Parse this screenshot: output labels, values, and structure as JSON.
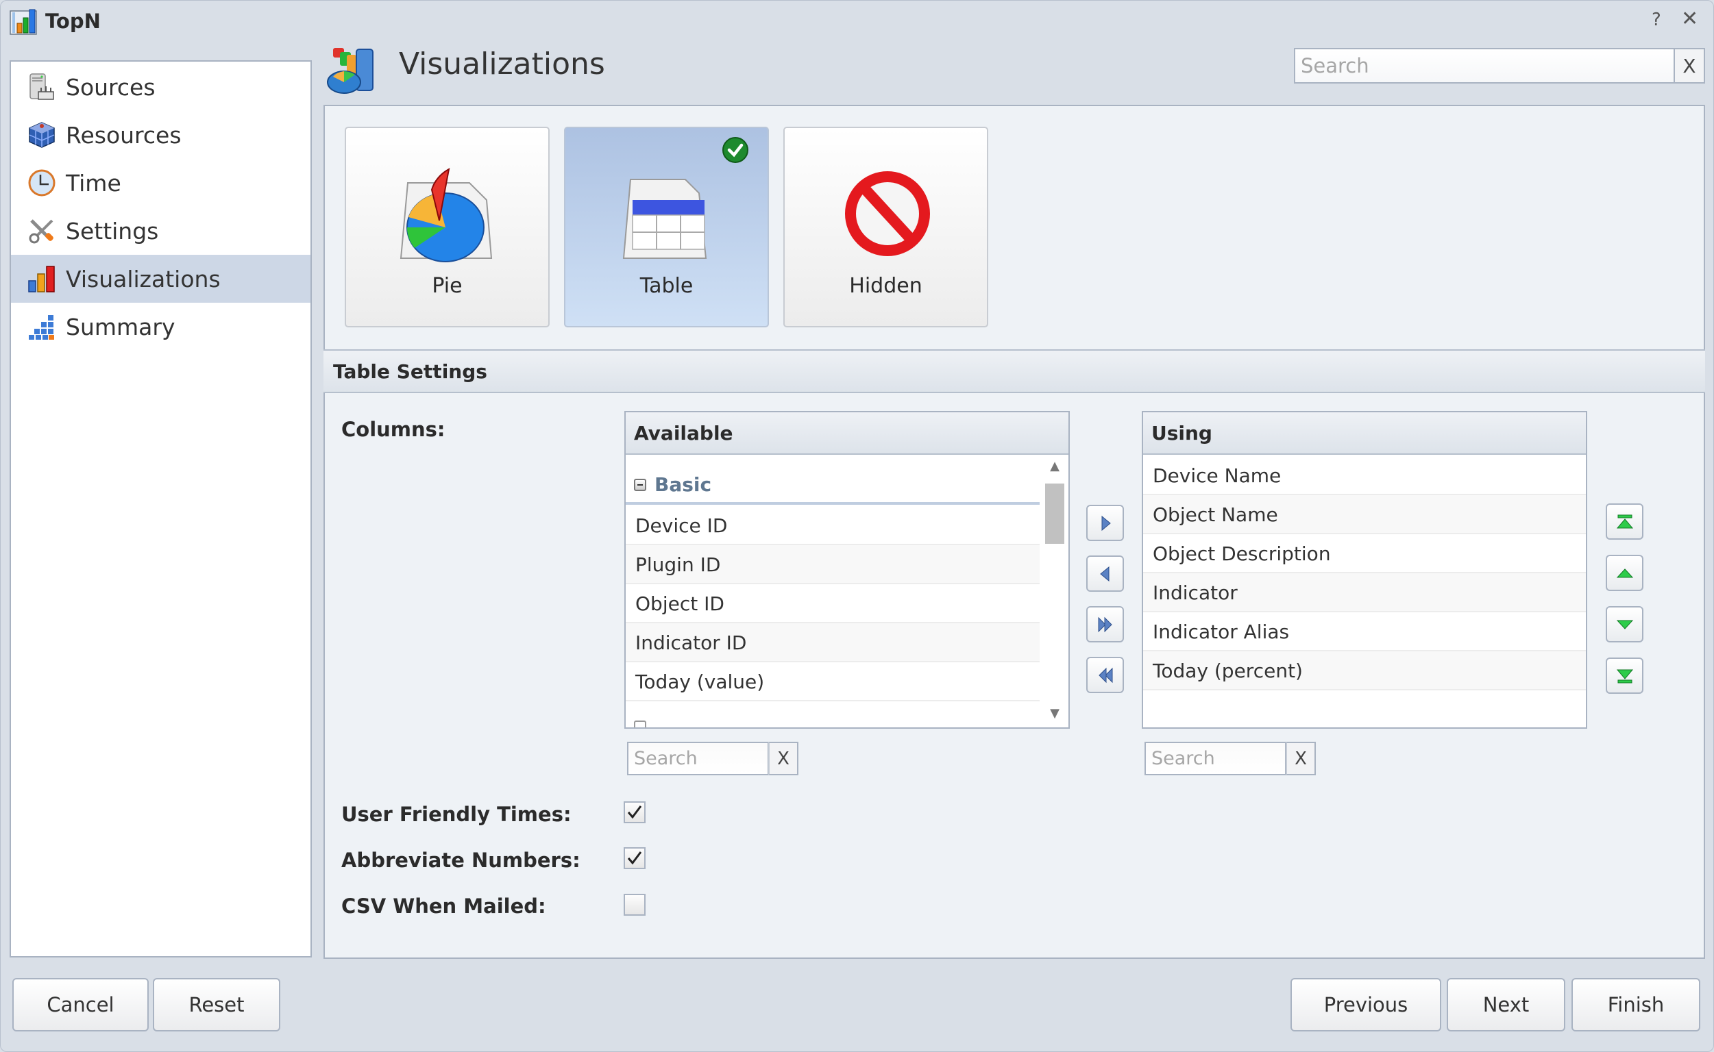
{
  "window": {
    "title": "TopN",
    "help_label": "?",
    "close_label": "✕"
  },
  "sidebar": {
    "items": [
      {
        "label": "Sources",
        "icon": "server-icon",
        "selected": false
      },
      {
        "label": "Resources",
        "icon": "cube-icon",
        "selected": false
      },
      {
        "label": "Time",
        "icon": "clock-icon",
        "selected": false
      },
      {
        "label": "Settings",
        "icon": "tools-icon",
        "selected": false
      },
      {
        "label": "Visualizations",
        "icon": "bar-chart-icon",
        "selected": true
      },
      {
        "label": "Summary",
        "icon": "summary-blocks-icon",
        "selected": false
      }
    ]
  },
  "header": {
    "title": "Visualizations",
    "search_placeholder": "Search",
    "search_value": "",
    "search_clear": "X"
  },
  "visualizations": {
    "tiles": [
      {
        "label": "Pie",
        "icon": "pie-chart-icon",
        "selected": false
      },
      {
        "label": "Table",
        "icon": "table-icon",
        "selected": true
      },
      {
        "label": "Hidden",
        "icon": "no-entry-icon",
        "selected": false
      }
    ]
  },
  "table_settings": {
    "title": "Table Settings",
    "columns_label": "Columns:",
    "available": {
      "header": "Available",
      "group": "Basic",
      "rows": [
        "Device ID",
        "Plugin ID",
        "Object ID",
        "Indicator ID",
        "Today (value)"
      ],
      "search_placeholder": "Search",
      "search_clear": "X"
    },
    "using": {
      "header": "Using",
      "rows": [
        "Device Name",
        "Object Name",
        "Object Description",
        "Indicator",
        "Indicator Alias",
        "Today (percent)"
      ],
      "search_placeholder": "Search",
      "search_clear": "X"
    },
    "options": [
      {
        "label": "User Friendly Times:",
        "checked": true
      },
      {
        "label": "Abbreviate Numbers:",
        "checked": true
      },
      {
        "label": "CSV When Mailed:",
        "checked": false
      }
    ]
  },
  "footer": {
    "cancel": "Cancel",
    "reset": "Reset",
    "previous": "Previous",
    "next": "Next",
    "finish": "Finish"
  },
  "colors": {
    "window_bg": "#d9dfe7",
    "panel_bg": "#eef2f6",
    "selected_sidebar": "#cdd7e6",
    "selected_tile": "#bcd0ea",
    "group_text": "#5f7790",
    "check_green": "#1e8a2e",
    "arrow_blue": "#5b82c4",
    "order_green": "#2ecc4a"
  }
}
